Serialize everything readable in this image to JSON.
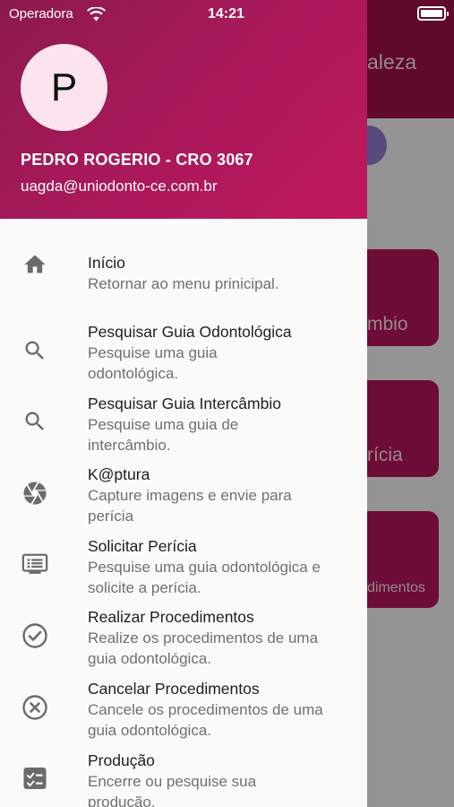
{
  "status_bar": {
    "carrier": "Operadora",
    "time": "14:21"
  },
  "background": {
    "title_fragment": "aleza",
    "cards": [
      "mbio",
      "rícia",
      "dimentos"
    ]
  },
  "drawer": {
    "avatar_letter": "P",
    "user_name": "PEDRO ROGERIO - CRO 3067",
    "user_email": "uagda@uniodonto-ce.com.br",
    "items": [
      {
        "icon": "home-icon",
        "title": "Início",
        "subtitle": "Retornar ao menu prinicipal."
      },
      {
        "icon": "search-icon",
        "title": "Pesquisar Guia Odontológica",
        "subtitle": "Pesquise uma guia odontológica."
      },
      {
        "icon": "search-icon",
        "title": "Pesquisar Guia Intercâmbio",
        "subtitle": "Pesquise uma guia de intercâmbio."
      },
      {
        "icon": "camera-shutter-icon",
        "title": "K@ptura",
        "subtitle": "Capture imagens e envie para perícia"
      },
      {
        "icon": "monitor-list-icon",
        "title": "Solicitar Perícia",
        "subtitle": "Pesquise uma guia odontológica e solicite a perícia."
      },
      {
        "icon": "check-circle-icon",
        "title": "Realizar Procedimentos",
        "subtitle": "Realize os procedimentos de uma guia odontológica."
      },
      {
        "icon": "cancel-circle-icon",
        "title": "Cancelar Procedimentos",
        "subtitle": "Cancele os procedimentos de uma guia odontológica."
      },
      {
        "icon": "checklist-icon",
        "title": "Produção",
        "subtitle": "Encerre ou pesquise sua produção."
      }
    ]
  },
  "colors": {
    "header_start": "#8c1a4e",
    "header_end": "#c0175e",
    "accent": "#b01457",
    "icon": "#6b6b6b"
  }
}
